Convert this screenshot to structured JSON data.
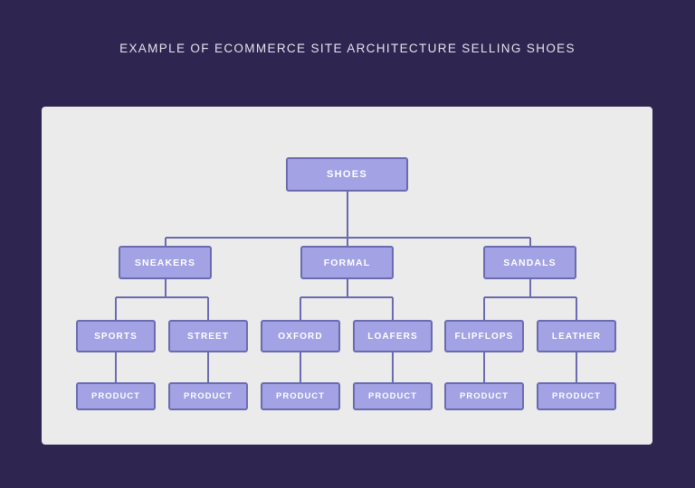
{
  "page": {
    "title": "EXAMPLE OF ECOMMERCE SITE ARCHITECTURE SELLING SHOES",
    "background_color": "#2e2550",
    "card_color": "#ebebeb",
    "node_fill_color": "#a2a2e5",
    "node_border_color": "#6b6bb0",
    "node_text_color": "#ffffff",
    "title_text_color": "#e6e3ef",
    "connector_color": "#6b6bb0"
  },
  "diagram": {
    "type": "tree",
    "orientation": "top-down",
    "levels": 4,
    "root": {
      "label": "SHOES",
      "children": [
        {
          "label": "SNEAKERS",
          "children": [
            {
              "label": "SPORTS",
              "children": [
                {
                  "label": "PRODUCT"
                }
              ]
            },
            {
              "label": "STREET",
              "children": [
                {
                  "label": "PRODUCT"
                }
              ]
            }
          ]
        },
        {
          "label": "FORMAL",
          "children": [
            {
              "label": "OXFORD",
              "children": [
                {
                  "label": "PRODUCT"
                }
              ]
            },
            {
              "label": "LOAFERS",
              "children": [
                {
                  "label": "PRODUCT"
                }
              ]
            }
          ]
        },
        {
          "label": "SANDALS",
          "children": [
            {
              "label": "FLIPFLOPS",
              "children": [
                {
                  "label": "PRODUCT"
                }
              ]
            },
            {
              "label": "LEATHER",
              "children": [
                {
                  "label": "PRODUCT"
                }
              ]
            }
          ]
        }
      ]
    },
    "nodes": {
      "level0": [
        {
          "label": "SHOES"
        }
      ],
      "level1": [
        {
          "label": "SNEAKERS"
        },
        {
          "label": "FORMAL"
        },
        {
          "label": "SANDALS"
        }
      ],
      "level2": [
        {
          "label": "SPORTS"
        },
        {
          "label": "STREET"
        },
        {
          "label": "OXFORD"
        },
        {
          "label": "LOAFERS"
        },
        {
          "label": "FLIPFLOPS"
        },
        {
          "label": "LEATHER"
        }
      ],
      "level3": [
        {
          "label": "PRODUCT"
        },
        {
          "label": "PRODUCT"
        },
        {
          "label": "PRODUCT"
        },
        {
          "label": "PRODUCT"
        },
        {
          "label": "PRODUCT"
        },
        {
          "label": "PRODUCT"
        }
      ]
    }
  }
}
